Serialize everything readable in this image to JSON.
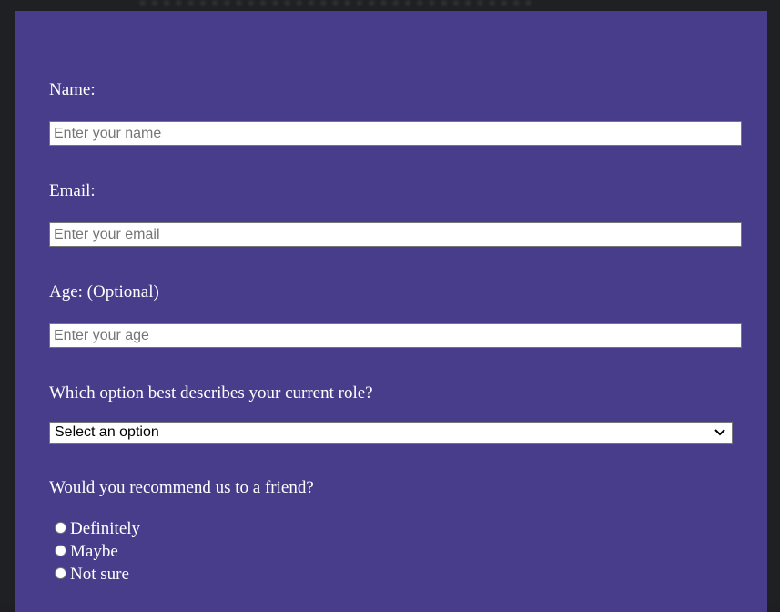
{
  "form": {
    "name": {
      "label": "Name:",
      "placeholder": "Enter your name",
      "value": ""
    },
    "email": {
      "label": "Email:",
      "placeholder": "Enter your email",
      "value": ""
    },
    "age": {
      "label": "Age: (Optional)",
      "placeholder": "Enter your age",
      "value": ""
    },
    "role": {
      "label": "Which option best describes your current role?",
      "selected": "Select an option"
    },
    "recommend": {
      "label": "Would you recommend us to a friend?",
      "options": [
        "Definitely",
        "Maybe",
        "Not sure"
      ]
    }
  },
  "colors": {
    "card_background": "#483d8b",
    "page_background": "#1f2023",
    "label_text": "#ffffff"
  }
}
